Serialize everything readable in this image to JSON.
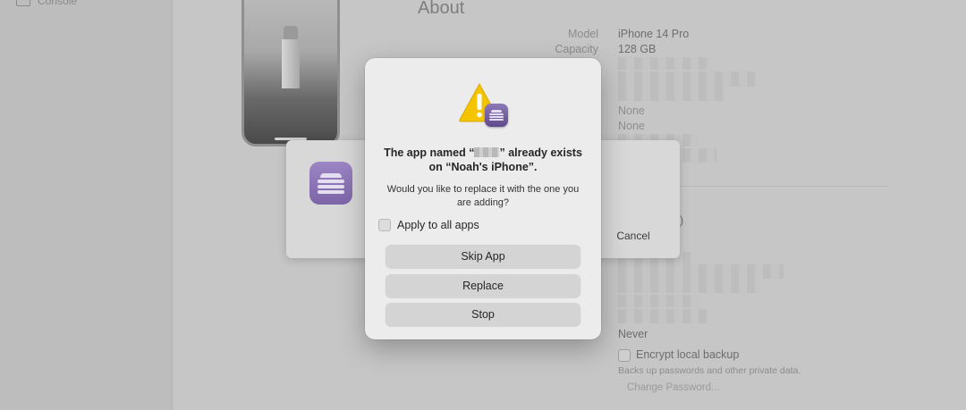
{
  "sidebar": {
    "console_label": "Console"
  },
  "about": {
    "title": "About",
    "rows": [
      {
        "label": "Model",
        "value": "iPhone 14 Pro"
      },
      {
        "label": "Capacity",
        "value": "128 GB"
      }
    ],
    "none_1": "None",
    "none_2": "None",
    "paren": ")",
    "never": "Never",
    "encrypt_label": "Encrypt local backup",
    "encrypt_sub": "Backs up passwords and other private data.",
    "change_password": "Change Password..."
  },
  "progress": {
    "cancel_label": "Cancel"
  },
  "dialog": {
    "title_prefix": "The app named “",
    "title_suffix": "” already exists on “Noah's iPhone”.",
    "message": "Would you like to replace it with the one you are adding?",
    "apply_all_label": "Apply to all apps",
    "apply_all_checked": false,
    "buttons": {
      "skip": "Skip App",
      "replace": "Replace",
      "stop": "Stop"
    },
    "icons": {
      "warning": "warning-icon",
      "app": "configurator-app-icon"
    },
    "colors": {
      "warning_yellow": "#f4c400",
      "app_purple": "#7c65a8"
    }
  }
}
